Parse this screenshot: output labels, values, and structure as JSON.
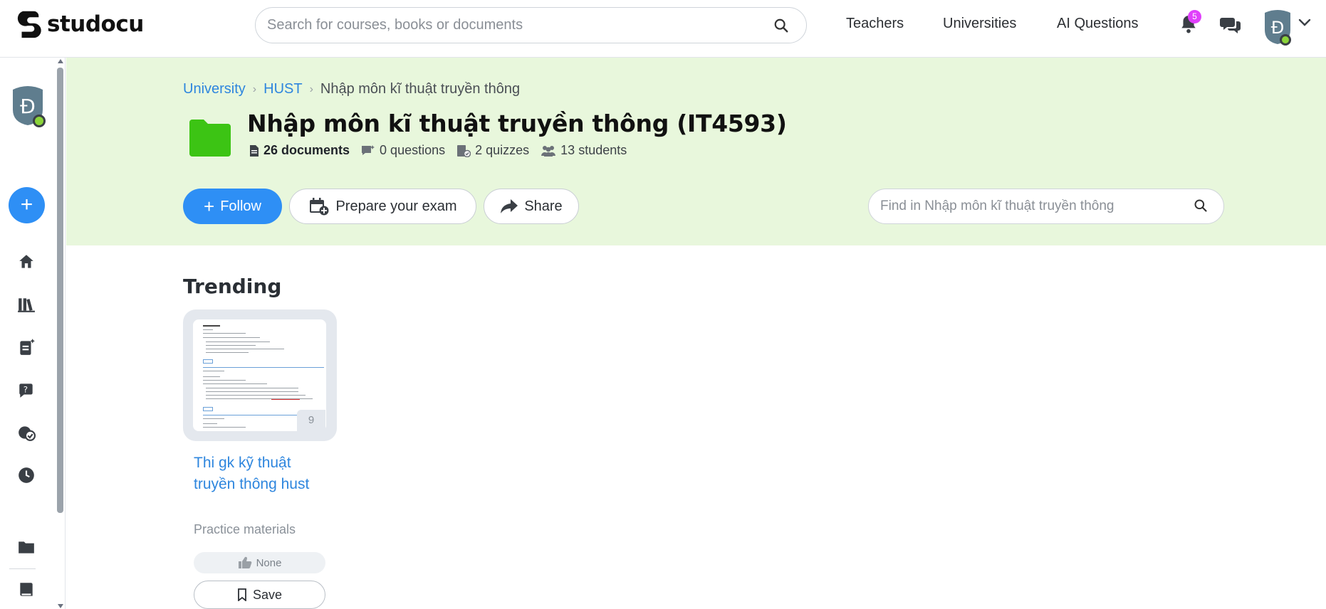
{
  "brand": {
    "name": "studocu"
  },
  "search": {
    "placeholder": "Search for courses, books or documents"
  },
  "nav": {
    "teachers": "Teachers",
    "universities": "Universities",
    "ai_questions": "AI Questions"
  },
  "notifications": {
    "count": "5"
  },
  "user": {
    "initial": "Đ"
  },
  "breadcrumb": {
    "level1": "University",
    "level2": "HUST",
    "current": "Nhập môn kĩ thuật truyền thông"
  },
  "course": {
    "title": "Nhập môn kĩ thuật truyền thông (IT4593)",
    "documents": "26 documents",
    "questions": "0 questions",
    "quizzes": "2 quizzes",
    "students": "13 students"
  },
  "actions": {
    "follow": "Follow",
    "prepare": "Prepare your exam",
    "share": "Share"
  },
  "find": {
    "placeholder": "Find in Nhập môn kĩ thuật truyền thông"
  },
  "trending": {
    "title": "Trending",
    "doc": {
      "title": "Thi gk kỹ thuật truyền thông hust",
      "pages": "9",
      "category": "Practice materials",
      "rating": "None",
      "save": "Save"
    }
  },
  "colors": {
    "accent": "#2e8ff5",
    "band": "#e8f7dc",
    "folder": "#3cc414",
    "badge": "#e040fb"
  }
}
